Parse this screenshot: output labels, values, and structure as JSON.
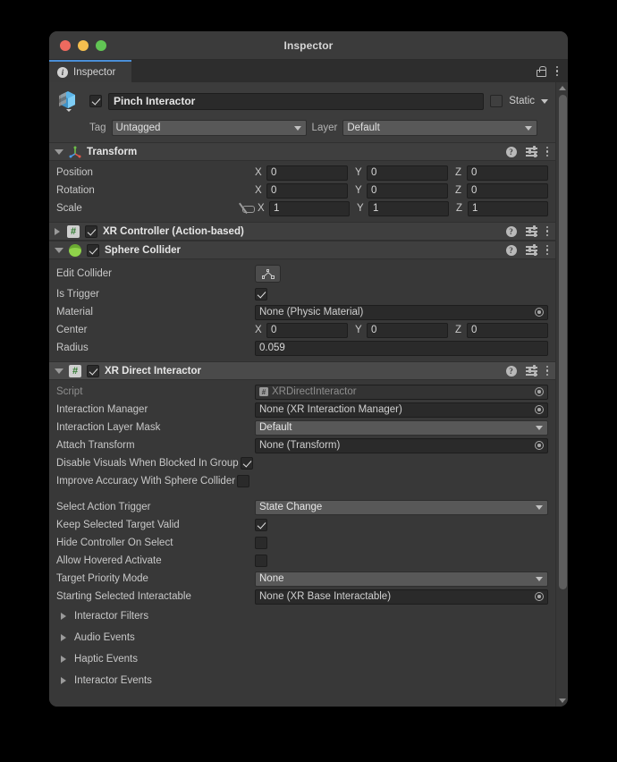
{
  "window": {
    "title": "Inspector",
    "traffic_lights": [
      "close-button",
      "minimize-button",
      "maximize-button"
    ]
  },
  "tabbar": {
    "tab_label": "Inspector",
    "tab_icon": "info-icon",
    "lock_icon": "lock-open-icon",
    "menu_icon": "kebab-menu-icon"
  },
  "gameobject": {
    "icon": "prefab-cube-icon",
    "enabled": true,
    "name": "Pinch Interactor",
    "static_checked": false,
    "static_label": "Static",
    "tag_label": "Tag",
    "tag_value": "Untagged",
    "layer_label": "Layer",
    "layer_value": "Default"
  },
  "components": [
    {
      "name": "Transform",
      "icon": "transform-gizmo-icon",
      "expanded": true,
      "has_enable_toggle": false,
      "rows": [
        {
          "kind": "vector3",
          "label": "Position",
          "x": "0",
          "y": "0",
          "z": "0"
        },
        {
          "kind": "vector3",
          "label": "Rotation",
          "x": "0",
          "y": "0",
          "z": "0"
        },
        {
          "kind": "vector3",
          "label": "Scale",
          "x": "1",
          "y": "1",
          "z": "1",
          "link_icon": "constrain-proportions-off-icon"
        }
      ]
    },
    {
      "name": "XR Controller (Action-based)",
      "icon": "script-icon",
      "expanded": false,
      "has_enable_toggle": true,
      "enabled": true,
      "rows": []
    },
    {
      "name": "Sphere Collider",
      "icon": "sphere-collider-icon",
      "expanded": true,
      "has_enable_toggle": true,
      "enabled": true,
      "rows": [
        {
          "kind": "button",
          "label": "Edit Collider",
          "button_icon": "edit-collider-icon"
        },
        {
          "kind": "checkbox",
          "label": "Is Trigger",
          "checked": true
        },
        {
          "kind": "object",
          "label": "Material",
          "value": "None (Physic Material)"
        },
        {
          "kind": "vector3",
          "label": "Center",
          "x": "0",
          "y": "0",
          "z": "0"
        },
        {
          "kind": "text",
          "label": "Radius",
          "value": "0.059"
        }
      ]
    },
    {
      "name": "XR Direct Interactor",
      "icon": "script-icon",
      "expanded": true,
      "selected": true,
      "has_enable_toggle": true,
      "enabled": true,
      "rows": [
        {
          "kind": "object",
          "label": "Script",
          "value": "XRDirectInteractor",
          "disabled": true
        },
        {
          "kind": "object",
          "label": "Interaction Manager",
          "value": "None (XR Interaction Manager)"
        },
        {
          "kind": "dropdown",
          "label": "Interaction Layer Mask",
          "value": "Default"
        },
        {
          "kind": "object",
          "label": "Attach Transform",
          "value": "None (Transform)"
        },
        {
          "kind": "checkbox-inline",
          "label": "Disable Visuals When Blocked In Group",
          "checked": true
        },
        {
          "kind": "checkbox-inline",
          "label": "Improve Accuracy With Sphere Collider",
          "checked": false
        },
        {
          "kind": "gap"
        },
        {
          "kind": "dropdown",
          "label": "Select Action Trigger",
          "value": "State Change"
        },
        {
          "kind": "checkbox",
          "label": "Keep Selected Target Valid",
          "checked": true
        },
        {
          "kind": "checkbox",
          "label": "Hide Controller On Select",
          "checked": false
        },
        {
          "kind": "checkbox",
          "label": "Allow Hovered Activate",
          "checked": false
        },
        {
          "kind": "dropdown",
          "label": "Target Priority Mode",
          "value": "None"
        },
        {
          "kind": "object",
          "label": "Starting Selected Interactable",
          "value": "None (XR Base Interactable)"
        }
      ],
      "foldouts": [
        "Interactor Filters",
        "Audio Events",
        "Haptic Events",
        "Interactor Events"
      ]
    }
  ],
  "scrollbar": {
    "up_arrow": "scroll-up-arrow",
    "down_arrow": "scroll-down-arrow"
  },
  "colors": {
    "window_bg": "#383838",
    "header_bg": "#3f3f3f",
    "selected_header_bg": "#4a4a4a",
    "field_bg": "#2a2a2a",
    "dropdown_bg": "#585858",
    "accent_tab": "#4a8fd8",
    "text": "#c8c8c8"
  }
}
